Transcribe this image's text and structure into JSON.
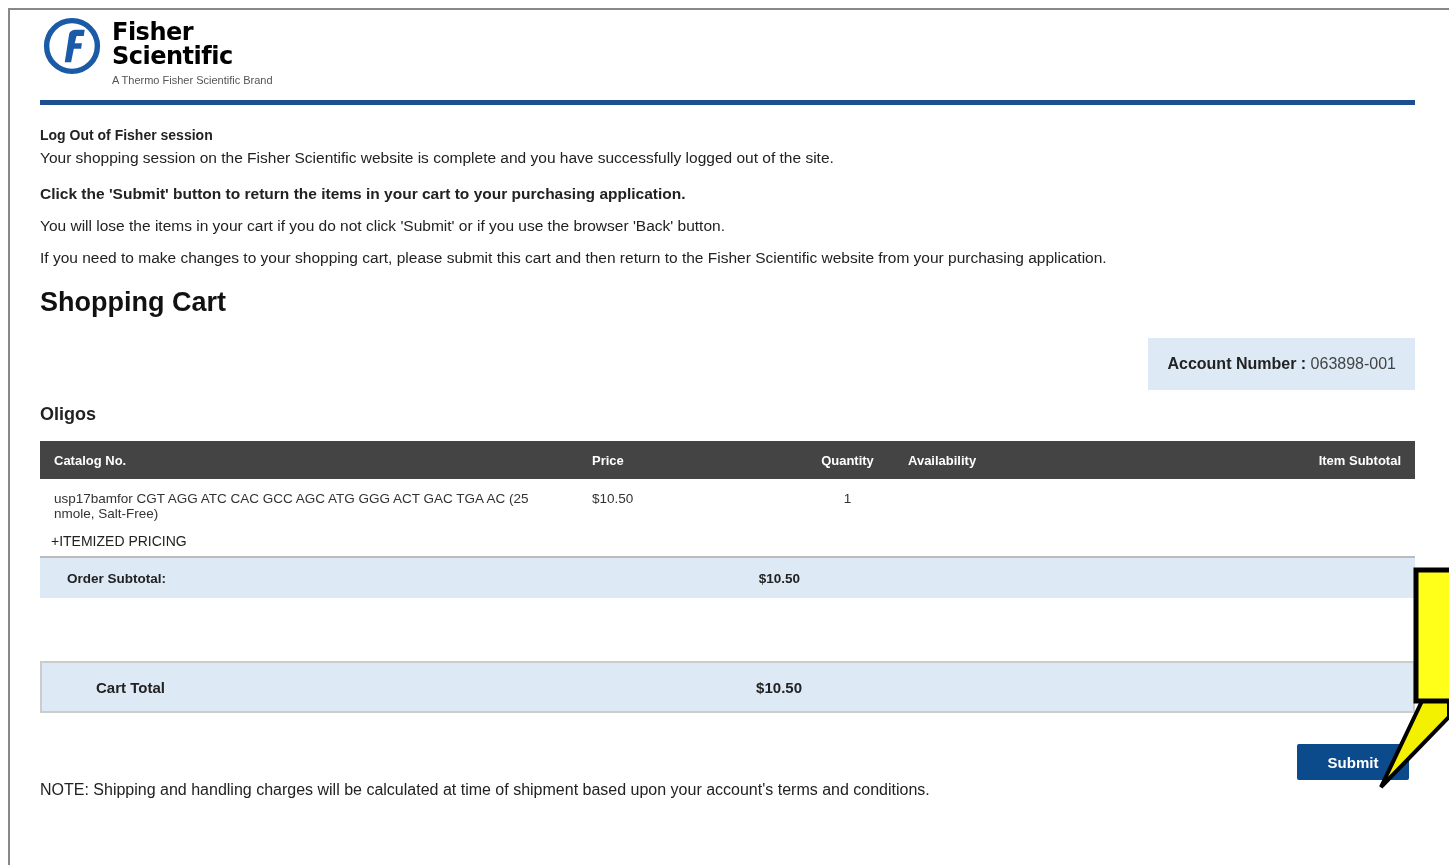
{
  "logo": {
    "name_line_1": "Fisher",
    "name_line_2": "Scientific",
    "tagline": "A Thermo Fisher Scientific Brand"
  },
  "logout": {
    "heading": "Log Out of Fisher session",
    "message": "Your shopping session on the Fisher Scientific website is complete and you have successfully logged out of the site.",
    "instruction": "Click the 'Submit' button to return the items in your cart to your purchasing application.",
    "warning": "You will lose the items in your cart if you do not click 'Submit' or if you use the browser 'Back' button.",
    "changes_note": "If you need to make changes to your shopping cart, please submit this cart and then return to the Fisher Scientific website from your purchasing application."
  },
  "cart": {
    "title": "Shopping Cart",
    "account_label": "Account Number :",
    "account_number": "063898-001",
    "section": "Oligos",
    "columns": [
      "Catalog No.",
      "Price",
      "Quantity",
      "Availability",
      "Item Subtotal"
    ],
    "rows": [
      {
        "catalog_no": "usp17bamfor CGT AGG ATC CAC GCC AGC ATG GGG ACT GAC TGA AC (25 nmole, Salt-Free)",
        "price": "$10.50",
        "quantity": "1"
      }
    ],
    "itemized": {
      "expand_icon": "+",
      "label": "ITEMIZED PRICING"
    },
    "order_subtotal": {
      "label": "Order Subtotal:",
      "value": "$10.50"
    },
    "cart_total": {
      "label": "Cart Total",
      "value": "$10.50"
    },
    "submit_button": "Submit"
  },
  "footer_note": "NOTE: Shipping and handling charges will be calculated at time of shipment based upon your account's terms and conditions."
}
